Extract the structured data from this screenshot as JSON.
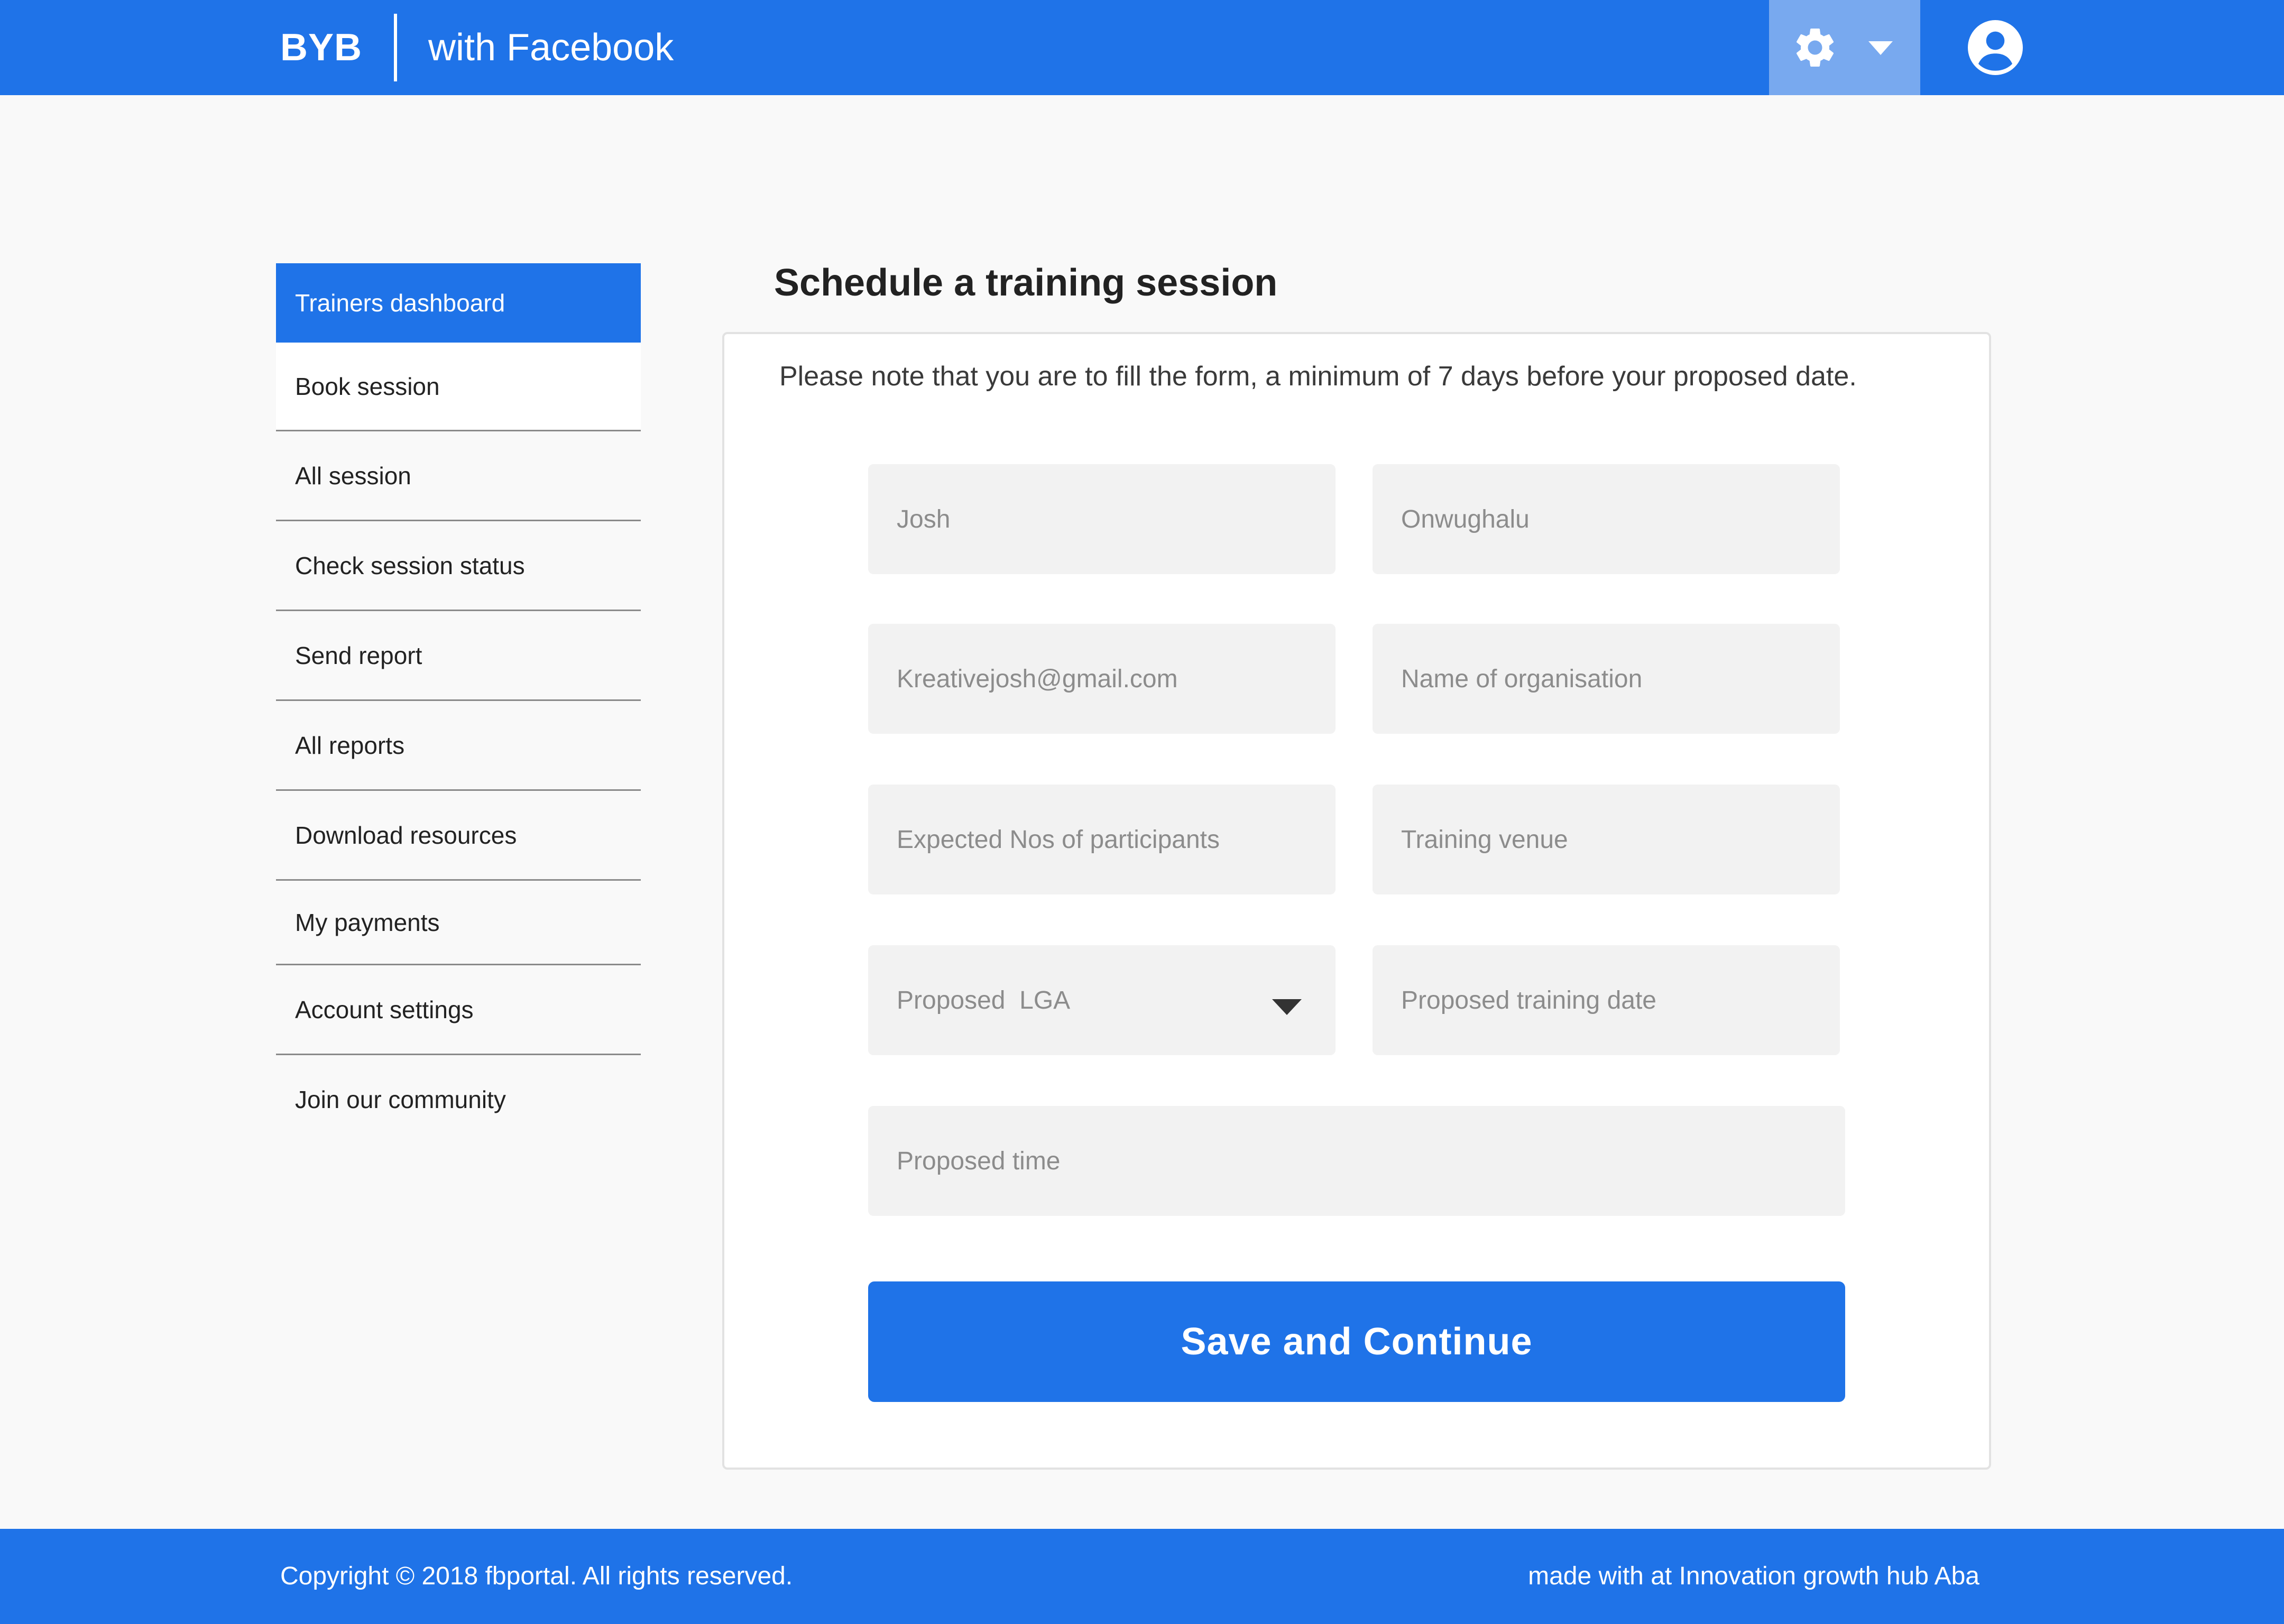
{
  "header": {
    "brand": "BYB",
    "brand_sub": "with Facebook",
    "settings_icon": "gear-icon",
    "dropdown_icon": "caret-down-icon",
    "user_icon": "user-circle-icon",
    "settings_bg_color": "#78a9ef"
  },
  "colors": {
    "primary": "#1f73e8",
    "page_background": "#f9f9f9",
    "field_background": "#f2f2f2",
    "placeholder_text": "#8c8c8c"
  },
  "sidebar": {
    "items": [
      {
        "label": "Trainers dashboard",
        "state": "active"
      },
      {
        "label": "Book session"
      },
      {
        "label": "All session"
      },
      {
        "label": "Check session status"
      },
      {
        "label": "Send report"
      },
      {
        "label": "All reports"
      },
      {
        "label": "Download resources"
      },
      {
        "label": "My payments"
      },
      {
        "label": "Account settings"
      },
      {
        "label": "Join our community"
      }
    ]
  },
  "main": {
    "title": "Schedule a training session",
    "note": "Please note that you are to fill the form, a minimum of 7 days before your proposed date.",
    "form": {
      "first_name": {
        "value": "Josh"
      },
      "last_name": {
        "value": "Onwughalu"
      },
      "email": {
        "value": "Kreativejosh@gmail.com"
      },
      "organisation": {
        "placeholder": "Name of organisation"
      },
      "participants": {
        "placeholder": "Expected Nos of participants"
      },
      "venue": {
        "placeholder": "Training venue"
      },
      "lga": {
        "placeholder": "Proposed  LGA"
      },
      "date": {
        "placeholder": "Proposed training date"
      },
      "time": {
        "placeholder": "Proposed time"
      }
    },
    "submit_label": "Save and Continue"
  },
  "footer": {
    "copyright": "Copyright © 2018 fbportal. All rights reserved.",
    "made_with": "made with at Innovation growth hub Aba"
  }
}
